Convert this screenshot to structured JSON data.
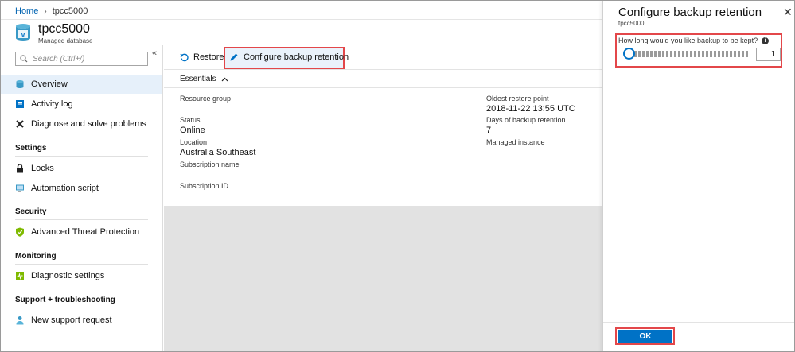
{
  "breadcrumb": {
    "home": "Home",
    "separator": "›",
    "current": "tpcc5000"
  },
  "header": {
    "title": "tpcc5000",
    "subtitle": "Managed database"
  },
  "sidebar": {
    "search_placeholder": "Search (Ctrl+/)",
    "collapse": "«",
    "overview": "Overview",
    "activity_log": "Activity log",
    "diagnose": "Diagnose and solve problems",
    "section_settings": "Settings",
    "locks": "Locks",
    "automation_script": "Automation script",
    "section_security": "Security",
    "advanced_threat": "Advanced Threat Protection",
    "section_monitoring": "Monitoring",
    "diagnostic_settings": "Diagnostic settings",
    "section_support": "Support + troubleshooting",
    "new_support_request": "New support request"
  },
  "toolbar": {
    "restore": "Restore",
    "configure": "Configure backup retention"
  },
  "essentials": {
    "label": "Essentials",
    "resource_group_label": "Resource group",
    "status_label": "Status",
    "status_value": "Online",
    "location_label": "Location",
    "location_value": "Australia Southeast",
    "subscription_name_label": "Subscription name",
    "subscription_id_label": "Subscription ID",
    "oldest_restore_label": "Oldest restore point",
    "oldest_restore_value": "2018-11-22 13:55 UTC",
    "days_retention_label": "Days of backup retention",
    "days_retention_value": "7",
    "managed_instance_label": "Managed instance"
  },
  "panel": {
    "title": "Configure backup retention",
    "subtitle": "tpcc5000",
    "close": "✕",
    "question": "How long would you like backup to be kept?",
    "info": "i",
    "slider_value": "1",
    "ok": "OK"
  },
  "colors": {
    "accent": "#0072c6",
    "highlight": "#e3474a",
    "active_nav": "#e6f0fa",
    "link": "#0063b1"
  }
}
